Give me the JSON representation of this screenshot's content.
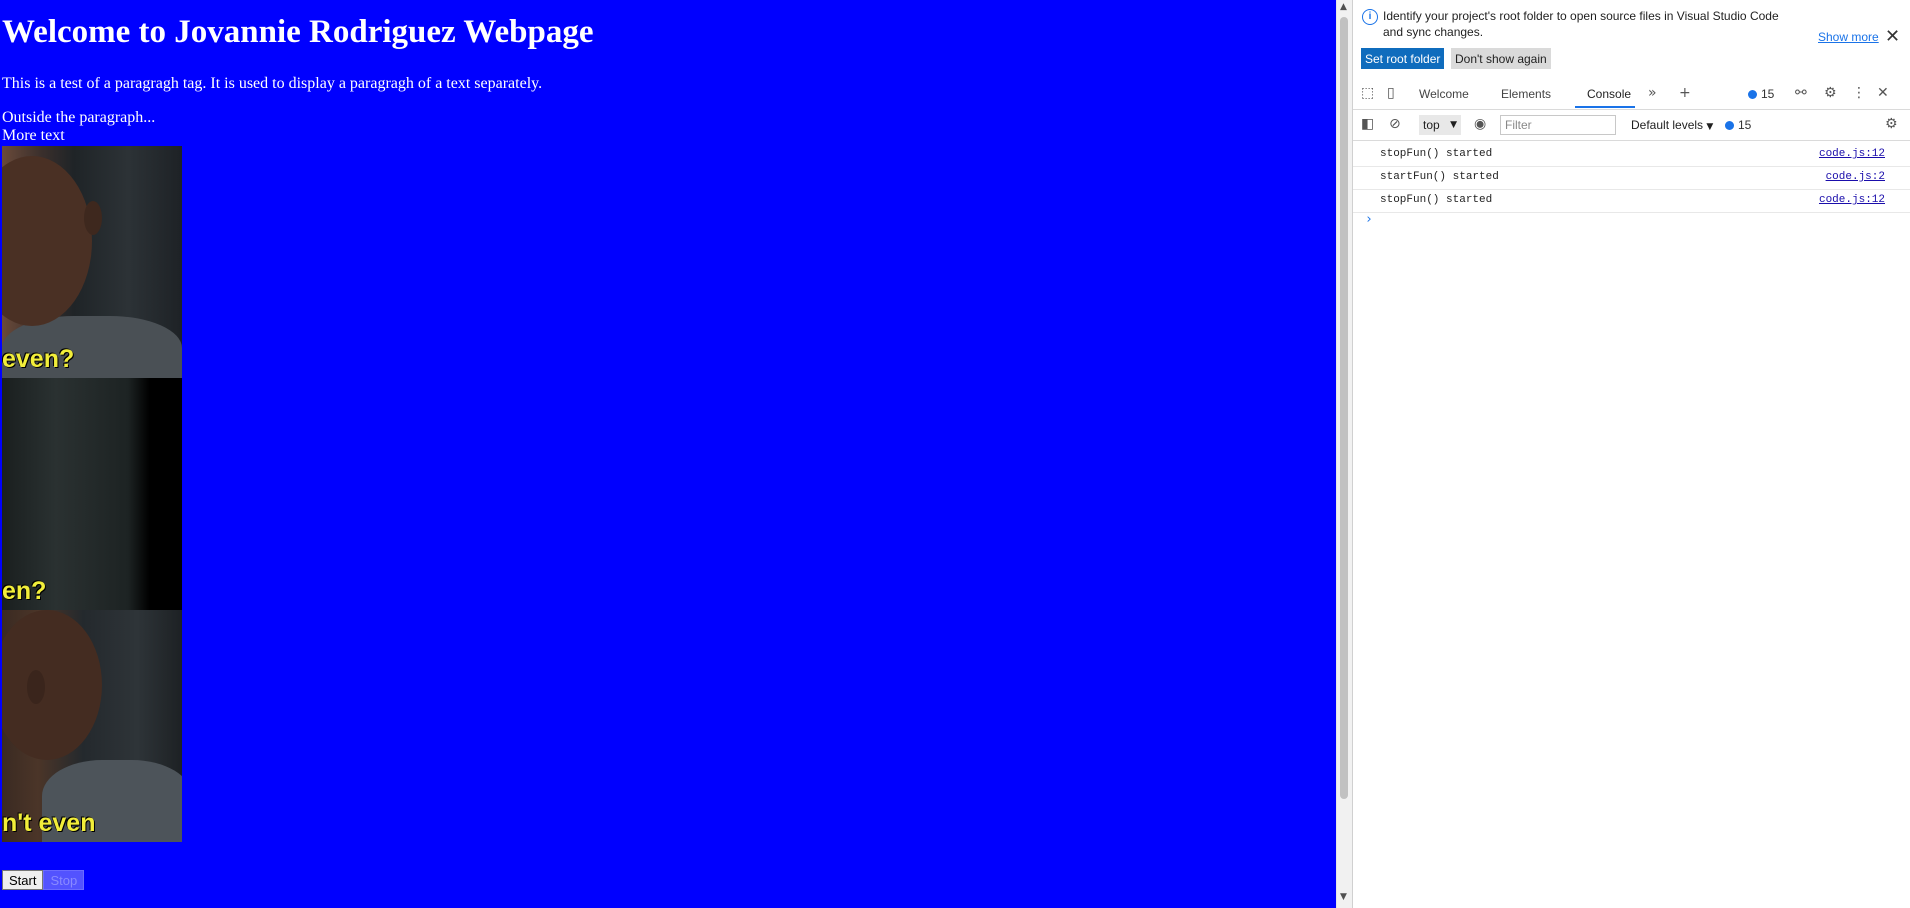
{
  "page": {
    "heading": "Welcome to Jovannie Rodriguez Webpage",
    "paragraph": "This is a test of a paragragh tag. It is used to display a paragragh of a text separately.",
    "outside_text": "Outside the paragraph...",
    "more_text": "More text",
    "gif_frames": [
      {
        "caption": "even?"
      },
      {
        "caption": "en?"
      },
      {
        "caption": "n't even"
      }
    ],
    "start_label": "Start",
    "stop_label": "Stop",
    "background_color": "#0000ff"
  },
  "devtools": {
    "infobar": {
      "message": "Identify your project's root folder to open source files in Visual Studio Code and sync changes.",
      "show_more": "Show more",
      "set_root_folder": "Set root folder",
      "dont_show_again": "Don't show again"
    },
    "tabs": [
      {
        "label": "Welcome"
      },
      {
        "label": "Elements"
      },
      {
        "label": "Console",
        "active": true
      }
    ],
    "issues_count": "15",
    "toolbar": {
      "context": "top",
      "filter_placeholder": "Filter",
      "levels": "Default levels",
      "messages_count": "15"
    },
    "console_rows": [
      {
        "text": "stopFun() started",
        "source": "code.js:12"
      },
      {
        "text": "startFun() started",
        "source": "code.js:2"
      },
      {
        "text": "stopFun() started",
        "source": "code.js:12"
      }
    ],
    "accent_color": "#1a73e8"
  }
}
